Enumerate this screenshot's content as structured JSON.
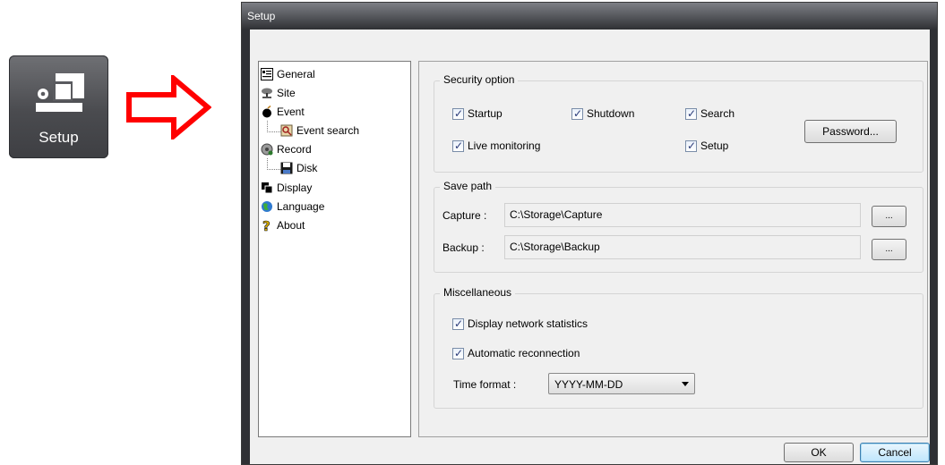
{
  "launcher": {
    "label": "Setup",
    "icon": "setup-icon"
  },
  "arrow": {
    "color": "#ff0000"
  },
  "dialog": {
    "title": "Setup",
    "tree": [
      {
        "label": "General",
        "icon": "general-icon"
      },
      {
        "label": "Site",
        "icon": "site-icon"
      },
      {
        "label": "Event",
        "icon": "event-icon"
      },
      {
        "label": "Event search",
        "icon": "event-search-icon"
      },
      {
        "label": "Record",
        "icon": "record-icon"
      },
      {
        "label": "Disk",
        "icon": "disk-icon"
      },
      {
        "label": "Display",
        "icon": "display-icon"
      },
      {
        "label": "Language",
        "icon": "language-icon"
      },
      {
        "label": "About",
        "icon": "about-icon"
      }
    ],
    "security": {
      "title": "Security option",
      "startup": "Startup",
      "shutdown": "Shutdown",
      "search": "Search",
      "live": "Live monitoring",
      "setup": "Setup",
      "password_button": "Password..."
    },
    "save_path": {
      "title": "Save path",
      "capture_label": "Capture :",
      "capture_value": "C:\\Storage\\Capture",
      "backup_label": "Backup :",
      "backup_value": "C:\\Storage\\Backup",
      "browse": "..."
    },
    "misc": {
      "title": "Miscellaneous",
      "network_stats": "Display network statistics",
      "auto_reconnect": "Automatic reconnection",
      "time_format_label": "Time format :",
      "time_format_value": "YYYY-MM-DD"
    },
    "ok": "OK",
    "cancel": "Cancel"
  }
}
